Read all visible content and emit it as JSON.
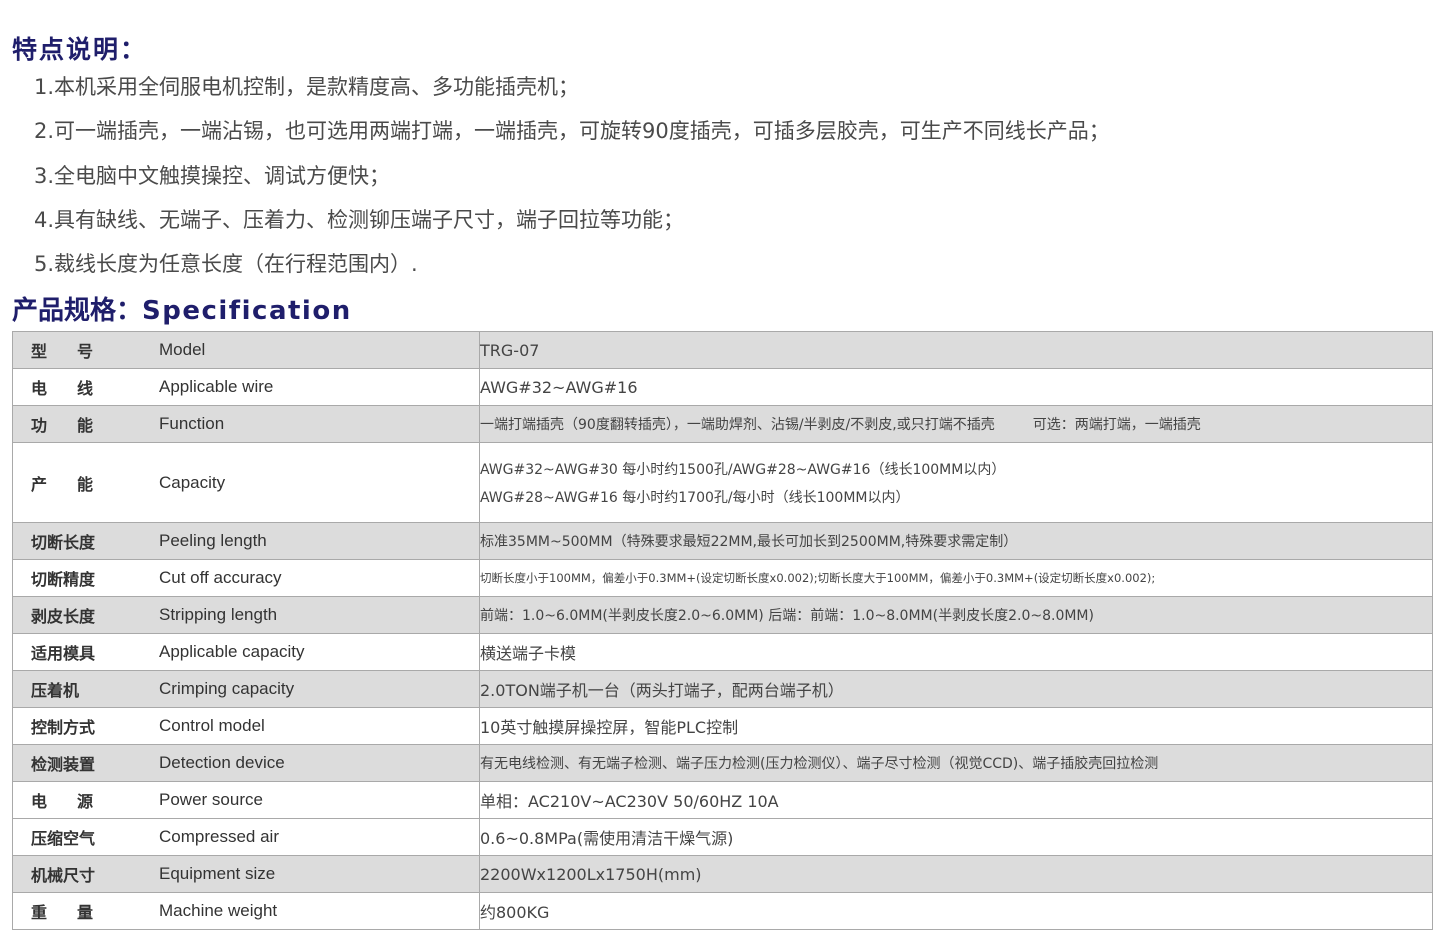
{
  "features": {
    "title": "特点说明：",
    "items": [
      "1.本机采用全伺服电机控制，是款精度高、多功能插壳机；",
      "2.可一端插壳，一端沾锡，也可选用两端打端，一端插壳，可旋转90度插壳，可插多层胶壳，可生产不同线长产品；",
      "3.全电脑中文触摸操控、调试方便快；",
      "4.具有缺线、无端子、压着力、检测铆压端子尺寸，端子回拉等功能；",
      "5.裁线长度为任意长度（在行程范围内）."
    ]
  },
  "spec": {
    "title_cn": "产品规格：",
    "title_en": "Specification",
    "rows": [
      {
        "cn": "型号",
        "en": "Model",
        "value": "TRG-07"
      },
      {
        "cn": "电线",
        "en": "Applicable wire",
        "value": "AWG#32~AWG#16"
      },
      {
        "cn": "功能",
        "en": "Function",
        "value": "一端打端插壳（90度翻转插壳），一端助焊剂、沾锡/半剥皮/不剥皮,或只打端不插壳",
        "value_extra": "可选：两端打端，一端插壳"
      },
      {
        "cn": "产能",
        "en": "Capacity",
        "value": "AWG#32~AWG#30  每小时约1500孔/AWG#28~AWG#16（线长100MM以内）",
        "value2": "AWG#28~AWG#16  每小时约1700孔/每小时（线长100MM以内）"
      },
      {
        "cn": "切断长度",
        "en": "Peeling length",
        "value": "标准35MM~500MM（特殊要求最短22MM,最长可加长到2500MM,特殊要求需定制）"
      },
      {
        "cn": "切断精度",
        "en": "Cut off accuracy",
        "value": "切断长度小于100MM，偏差小于0.3MM+(设定切断长度x0.002);切断长度大于100MM，偏差小于0.3MM+(设定切断长度x0.002);"
      },
      {
        "cn": "剥皮长度",
        "en": "Stripping length",
        "value": "前端：1.0~6.0MM(半剥皮长度2.0~6.0MM) 后端：前端：1.0~8.0MM(半剥皮长度2.0~8.0MM)"
      },
      {
        "cn": "适用模具",
        "en": "Applicable capacity",
        "value": "横送端子卡模"
      },
      {
        "cn": "压着机",
        "en": "Crimping capacity",
        "value": "2.0TON端子机一台（两头打端子，配两台端子机）"
      },
      {
        "cn": "控制方式",
        "en": "Control model",
        "value": "10英寸触摸屏操控屏，智能PLC控制"
      },
      {
        "cn": "检测装置",
        "en": "Detection device",
        "value": "有无电线检测、有无端子检测、端子压力检测(压力检测仪）、端子尽寸检测（视觉CCD)、端子插胶壳回拉检测"
      },
      {
        "cn": "电源",
        "en": "Power source",
        "value": "单相：AC210V~AC230V  50/60HZ  10A"
      },
      {
        "cn": "压缩空气",
        "en": "Compressed air",
        "value": "0.6~0.8MPa(需使用清洁干燥气源)"
      },
      {
        "cn": "机械尺寸",
        "en": "Equipment size",
        "value": "2200Wx1200Lx1750H(mm)"
      },
      {
        "cn": "重量",
        "en": "Machine weight",
        "value": "约800KG"
      }
    ]
  }
}
